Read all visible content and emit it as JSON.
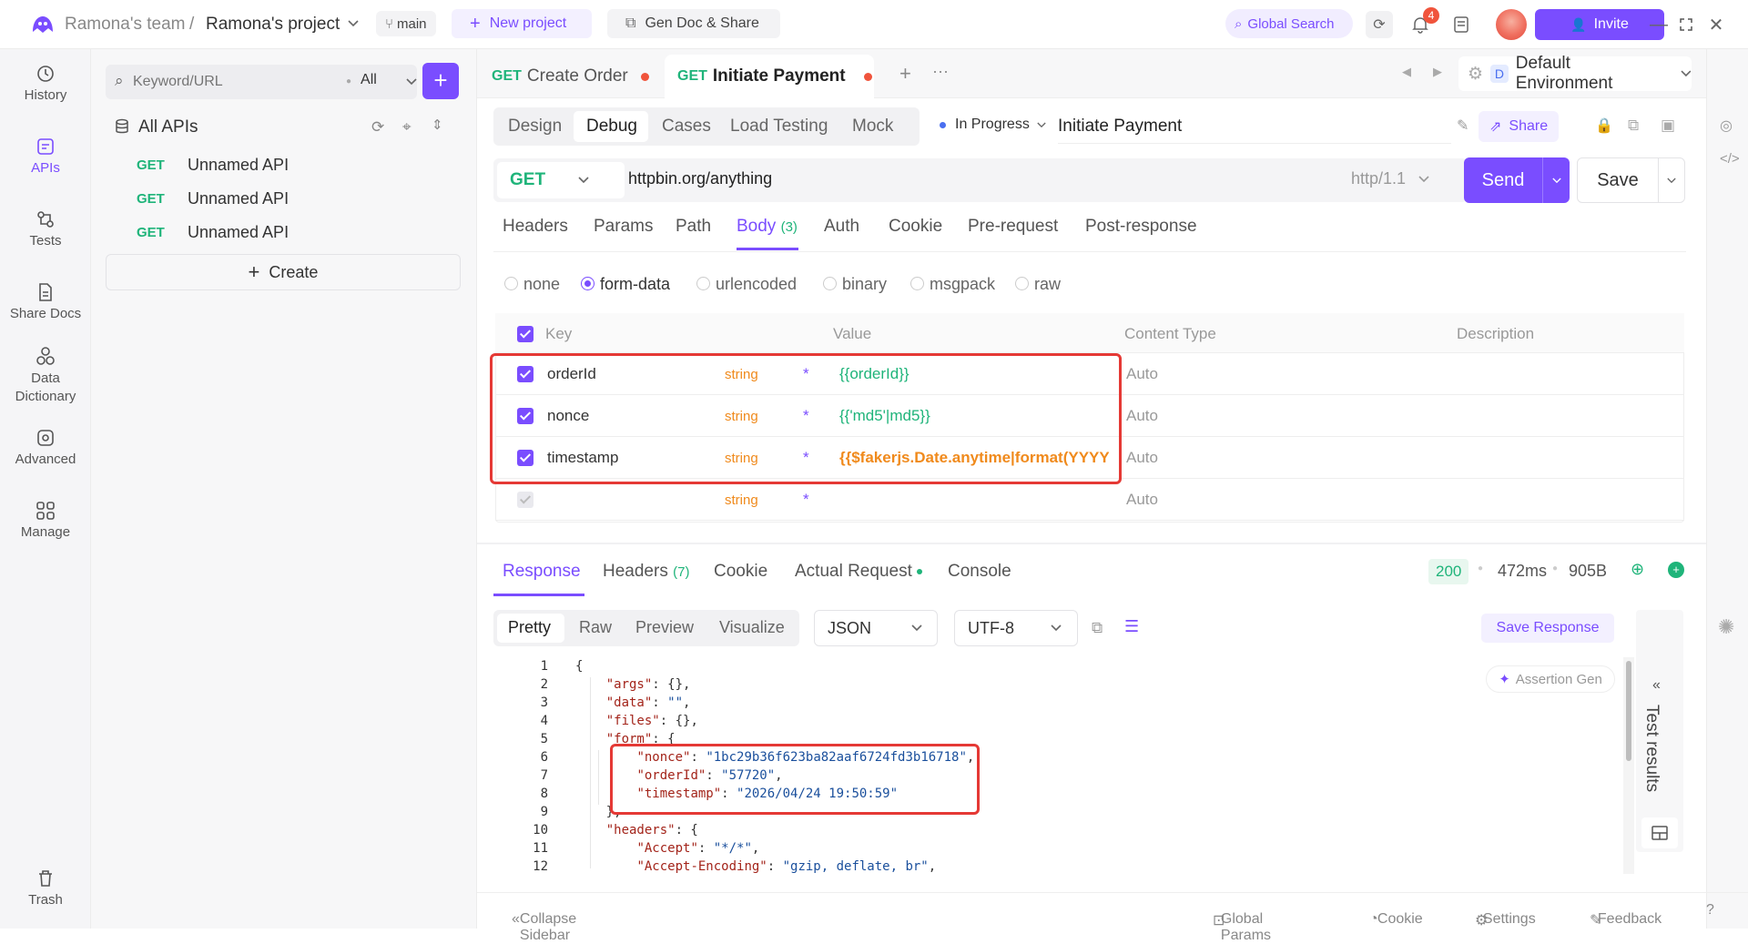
{
  "titlebar": {
    "team": "Ramona's team",
    "separator": "/",
    "project": "Ramona's project",
    "branch": "main",
    "new_project": "New project",
    "gen_doc": "Gen Doc & Share",
    "global_search": "Global Search",
    "notification_count": "4",
    "invite": "Invite"
  },
  "leftnav": {
    "items": [
      {
        "label": "History"
      },
      {
        "label": "APIs"
      },
      {
        "label": "Tests"
      },
      {
        "label": "Share Docs"
      },
      {
        "label": "Data Dictionary"
      },
      {
        "label": "Advanced"
      },
      {
        "label": "Manage"
      },
      {
        "label": "Trash"
      }
    ]
  },
  "sidebar": {
    "search_placeholder": "Keyword/URL",
    "filter": "All",
    "tree_title": "All APIs",
    "apis": [
      {
        "method": "GET",
        "name": "Unnamed API"
      },
      {
        "method": "GET",
        "name": "Unnamed API"
      },
      {
        "method": "GET",
        "name": "Unnamed API"
      }
    ],
    "create": "Create"
  },
  "tabs": [
    {
      "method": "GET",
      "name": "Create Order"
    },
    {
      "method": "GET",
      "name": "Initiate Payment"
    }
  ],
  "environment": {
    "badge": "D",
    "name": "Default Environment"
  },
  "modes": [
    "Design",
    "Debug",
    "Cases",
    "Load Testing",
    "Mock"
  ],
  "status": "In Progress",
  "api_name": "Initiate Payment",
  "share": "Share",
  "request": {
    "method": "GET",
    "url": "httpbin.org/anything",
    "protocol": "http/1.1",
    "send": "Send",
    "save": "Save"
  },
  "request_tabs": [
    {
      "label": "Headers"
    },
    {
      "label": "Params"
    },
    {
      "label": "Path"
    },
    {
      "label": "Body",
      "count": "(3)"
    },
    {
      "label": "Auth"
    },
    {
      "label": "Cookie"
    },
    {
      "label": "Pre-request"
    },
    {
      "label": "Post-response"
    }
  ],
  "body_types": [
    "none",
    "form-data",
    "urlencoded",
    "binary",
    "msgpack",
    "raw"
  ],
  "params_table": {
    "headers": [
      "Key",
      "Value",
      "Content Type",
      "Description"
    ],
    "rows": [
      {
        "key": "orderId",
        "type": "string",
        "value": "{{orderId}}",
        "content_type": "Auto"
      },
      {
        "key": "nonce",
        "type": "string",
        "value": "{{'md5'|md5}}",
        "content_type": "Auto"
      },
      {
        "key": "timestamp",
        "type": "string",
        "value": "{{$fakerjs.Date.anytime|format(YYYY",
        "content_type": "Auto"
      },
      {
        "key": "",
        "type": "string",
        "value": "",
        "content_type": "Auto"
      }
    ]
  },
  "response": {
    "tabs": [
      {
        "label": "Response"
      },
      {
        "label": "Headers",
        "count": "(7)"
      },
      {
        "label": "Cookie"
      },
      {
        "label": "Actual Request"
      },
      {
        "label": "Console"
      }
    ],
    "status_code": "200",
    "time": "472ms",
    "size": "905B",
    "view_modes": [
      "Pretty",
      "Raw",
      "Preview",
      "Visualize"
    ],
    "format": "JSON",
    "encoding": "UTF-8",
    "save_response": "Save Response",
    "assertion_gen": "Assertion Gen",
    "test_results": "Test results",
    "code_lines": [
      {
        "n": "1",
        "parts": [
          {
            "t": "{",
            "c": "p"
          }
        ]
      },
      {
        "n": "2",
        "parts": [
          {
            "t": "    ",
            "c": "p"
          },
          {
            "t": "\"args\"",
            "c": "k"
          },
          {
            "t": ": {},",
            "c": "p"
          }
        ]
      },
      {
        "n": "3",
        "parts": [
          {
            "t": "    ",
            "c": "p"
          },
          {
            "t": "\"data\"",
            "c": "k"
          },
          {
            "t": ": ",
            "c": "p"
          },
          {
            "t": "\"\"",
            "c": "s"
          },
          {
            "t": ",",
            "c": "p"
          }
        ]
      },
      {
        "n": "4",
        "parts": [
          {
            "t": "    ",
            "c": "p"
          },
          {
            "t": "\"files\"",
            "c": "k"
          },
          {
            "t": ": {},",
            "c": "p"
          }
        ]
      },
      {
        "n": "5",
        "parts": [
          {
            "t": "    ",
            "c": "p"
          },
          {
            "t": "\"form\"",
            "c": "k"
          },
          {
            "t": ": {",
            "c": "p"
          }
        ]
      },
      {
        "n": "6",
        "parts": [
          {
            "t": "        ",
            "c": "p"
          },
          {
            "t": "\"nonce\"",
            "c": "k"
          },
          {
            "t": ": ",
            "c": "p"
          },
          {
            "t": "\"1bc29b36f623ba82aaf6724fd3b16718\"",
            "c": "s"
          },
          {
            "t": ",",
            "c": "p"
          }
        ]
      },
      {
        "n": "7",
        "parts": [
          {
            "t": "        ",
            "c": "p"
          },
          {
            "t": "\"orderId\"",
            "c": "k"
          },
          {
            "t": ": ",
            "c": "p"
          },
          {
            "t": "\"57720\"",
            "c": "s"
          },
          {
            "t": ",",
            "c": "p"
          }
        ]
      },
      {
        "n": "8",
        "parts": [
          {
            "t": "        ",
            "c": "p"
          },
          {
            "t": "\"timestamp\"",
            "c": "k"
          },
          {
            "t": ": ",
            "c": "p"
          },
          {
            "t": "\"2026/04/24 19:50:59\"",
            "c": "s"
          }
        ]
      },
      {
        "n": "9",
        "parts": [
          {
            "t": "    },",
            "c": "p"
          }
        ]
      },
      {
        "n": "10",
        "parts": [
          {
            "t": "    ",
            "c": "p"
          },
          {
            "t": "\"headers\"",
            "c": "k"
          },
          {
            "t": ": {",
            "c": "p"
          }
        ]
      },
      {
        "n": "11",
        "parts": [
          {
            "t": "        ",
            "c": "p"
          },
          {
            "t": "\"Accept\"",
            "c": "k"
          },
          {
            "t": ": ",
            "c": "p"
          },
          {
            "t": "\"*/*\"",
            "c": "s"
          },
          {
            "t": ",",
            "c": "p"
          }
        ]
      },
      {
        "n": "12",
        "parts": [
          {
            "t": "        ",
            "c": "p"
          },
          {
            "t": "\"Accept-Encoding\"",
            "c": "k"
          },
          {
            "t": ": ",
            "c": "p"
          },
          {
            "t": "\"gzip, deflate, br\"",
            "c": "s"
          },
          {
            "t": ",",
            "c": "p"
          }
        ]
      }
    ]
  },
  "footer": {
    "collapse": "Collapse Sidebar",
    "global_params": "Global Params",
    "cookie": "Cookie",
    "settings": "Settings",
    "feedback": "Feedback"
  },
  "colors": {
    "accent": "#7a4dff",
    "get": "#1fb47a",
    "string_type": "#f08a1c",
    "highlight": "#e53935"
  }
}
